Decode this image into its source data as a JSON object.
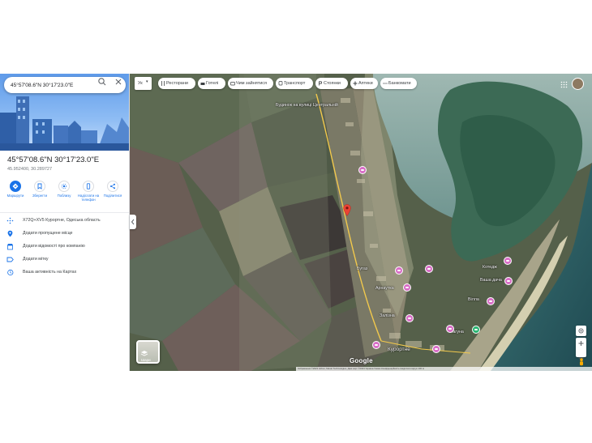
{
  "search": {
    "value": "45°57'08.6\"N 30°17'23.0\"E",
    "placeholder": ""
  },
  "place": {
    "title": "45°57'08.6\"N 30°17'23.0\"E",
    "decimal": "45.952400, 30.289727"
  },
  "actions": [
    {
      "label": "Маршрути",
      "icon": "directions-icon"
    },
    {
      "label": "Зберегти",
      "icon": "bookmark-icon"
    },
    {
      "label": "Поблизу",
      "icon": "nearby-icon"
    },
    {
      "label": "Надіслати на телефон",
      "icon": "send-to-phone-icon"
    },
    {
      "label": "Поділитися",
      "icon": "share-icon"
    }
  ],
  "info_rows": [
    {
      "text": "X72Q+XV5 Курортне, Одеська область",
      "icon": "plus-code-icon"
    },
    {
      "text": "Додати пропущене місце",
      "icon": "add-place-icon"
    },
    {
      "text": "Додати відомості про компанію",
      "icon": "add-business-icon"
    },
    {
      "text": "Додати мітку",
      "icon": "label-icon"
    },
    {
      "text": "Ваша активність на Картах",
      "icon": "history-icon"
    }
  ],
  "map": {
    "language_chip": "Ук",
    "chips": [
      {
        "label": "Ресторани",
        "icon": "restaurant-icon"
      },
      {
        "label": "Готелі",
        "icon": "hotel-icon"
      },
      {
        "label": "Чим зайнятися",
        "icon": "things-to-do-icon"
      },
      {
        "label": "Транспорт",
        "icon": "transit-icon"
      },
      {
        "label": "Стоянки",
        "icon": "parking-icon"
      },
      {
        "label": "Аптеки",
        "icon": "pharmacy-icon"
      },
      {
        "label": "Банкомати",
        "icon": "atm-icon"
      }
    ],
    "layers_label": "Шари",
    "logo": "Google",
    "attribution": "Зображення ©2023 Airbus, Maxar Technologies, Дані карт ©2023   Україна   Умови   Конфіденційність   Надіслати відгук   100 м",
    "places": [
      {
        "label": "Курортне"
      },
      {
        "label": "Будинок на вулиці Центральній"
      },
      {
        "label": "Бугаз"
      },
      {
        "label": "Арнаутка"
      },
      {
        "label": "Залізна"
      },
      {
        "label": "Котедж"
      },
      {
        "label": "Ваша дача"
      },
      {
        "label": "Вілла"
      },
      {
        "label": "Лагуна"
      }
    ],
    "colors": {
      "road": "#f2c94c",
      "poi": "#d96ec7",
      "pin": "#ea4335",
      "water": "#2f5a5c",
      "accent": "#1a73e8"
    }
  }
}
